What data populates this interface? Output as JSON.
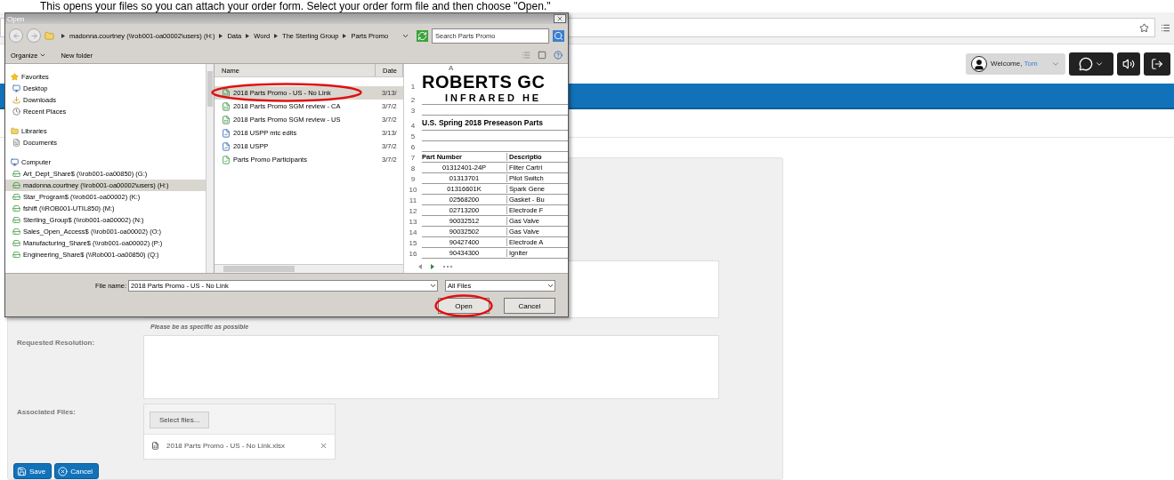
{
  "caption": "This opens your files so you can attach your order form. Select your order form file and then choose \"Open.\"",
  "header": {
    "welcome": "Welcome,",
    "user": "Tom"
  },
  "form": {
    "hint": "Please be as specific as possible",
    "resolution_label": "Requested Resolution:",
    "files_label": "Associated Files:",
    "select_button": "Select files...",
    "attached": [
      {
        "name": "2018 Parts Promo - US - No Link.xlsx"
      }
    ],
    "buttons": [
      {
        "label": "Save",
        "kind": "save"
      },
      {
        "label": "Cancel",
        "kind": "cancel"
      }
    ]
  },
  "dialog": {
    "title": "Open",
    "breadcrumb": [
      "madonna.courtney (\\\\rob001-oa00002\\users) (H:)",
      "Data",
      "Word",
      "The Sterling Group",
      "Parts Promo"
    ],
    "search_placeholder": "Search Parts Promo",
    "toolbar": [
      "Organize",
      "New folder"
    ],
    "nav": [
      {
        "label": "Favorites",
        "kind": "favorites",
        "children": [
          {
            "label": "Desktop",
            "kind": "desktop",
            "selected": false
          },
          {
            "label": "Downloads",
            "kind": "downloads",
            "selected": false
          },
          {
            "label": "Recent Places",
            "kind": "recent",
            "selected": false
          }
        ]
      },
      {
        "label": "Libraries",
        "kind": "libraries",
        "children": [
          {
            "label": "Documents",
            "kind": "document",
            "selected": false
          }
        ]
      },
      {
        "label": "Computer",
        "kind": "computer",
        "children": [
          {
            "label": "Art_Dept_Share$ (\\\\rob001-oa00850) (G:)",
            "kind": "drive",
            "selected": false
          },
          {
            "label": "madonna.courtney (\\\\rob001-oa00002\\users) (H:)",
            "kind": "drive",
            "selected": true
          },
          {
            "label": "Star_Program$ (\\\\rob001-oa00002) (K:)",
            "kind": "drive",
            "selected": false
          },
          {
            "label": "fshift (\\\\ROB001-UTIL850) (M:)",
            "kind": "drive",
            "selected": false
          },
          {
            "label": "Sterling_Group$ (\\\\rob001-oa00002) (N:)",
            "kind": "drive",
            "selected": false
          },
          {
            "label": "Sales_Open_Access$ (\\\\rob001-oa00002) (O:)",
            "kind": "drive",
            "selected": false
          },
          {
            "label": "Manufacturing_Share$ (\\\\rob001-oa00002) (P:)",
            "kind": "drive",
            "selected": false
          },
          {
            "label": "Engineering_Share$ (\\\\Rob001-oa00850) (Q:)",
            "kind": "drive",
            "selected": false
          }
        ]
      }
    ],
    "columns": [
      "Name",
      "Date"
    ],
    "files": [
      {
        "name": "2018 Parts Promo - US - No Link",
        "date": "3/13/",
        "kind": "workbook",
        "selected": true,
        "circled": true
      },
      {
        "name": "2018 Parts Promo SGM review - CA",
        "date": "3/7/2",
        "kind": "workbook",
        "selected": false,
        "circled": false
      },
      {
        "name": "2018 Parts Promo SGM review - US",
        "date": "3/7/2",
        "kind": "workbook",
        "selected": false,
        "circled": false
      },
      {
        "name": "2018 USPP mtc edits",
        "date": "3/13/",
        "kind": "document",
        "selected": false,
        "circled": false
      },
      {
        "name": "2018 USPP",
        "date": "3/7/2",
        "kind": "document",
        "selected": false,
        "circled": false
      },
      {
        "name": "Parts Promo Participants",
        "date": "3/7/2",
        "kind": "list",
        "selected": false,
        "circled": false
      }
    ],
    "preview": {
      "column": "A",
      "rows": [
        {
          "n": "1",
          "kind": "logo",
          "text": "ROBERTS GC"
        },
        {
          "n": "2",
          "kind": "logo-sub",
          "text": "INFRARED HE"
        },
        {
          "n": "3",
          "kind": "blank"
        },
        {
          "n": "4",
          "kind": "title",
          "text": "U.S. Spring 2018 Preseason Parts"
        },
        {
          "n": "5",
          "kind": "blank"
        },
        {
          "n": "6",
          "kind": "blank"
        },
        {
          "n": "7",
          "kind": "header",
          "cells": [
            "Part Number",
            "Descriptio"
          ]
        },
        {
          "n": "8",
          "kind": "data",
          "cells": [
            "01312401-24P",
            "Filter Cartri"
          ]
        },
        {
          "n": "9",
          "kind": "data",
          "cells": [
            "01313701",
            "Pilot Switch"
          ]
        },
        {
          "n": "10",
          "kind": "data",
          "cells": [
            "01316601K",
            "Spark Gene"
          ]
        },
        {
          "n": "11",
          "kind": "data",
          "cells": [
            "02568200",
            "Gasket - Bu"
          ]
        },
        {
          "n": "12",
          "kind": "data",
          "cells": [
            "02713200",
            "Electrode F"
          ]
        },
        {
          "n": "13",
          "kind": "data",
          "cells": [
            "90032512",
            "Gas Valve"
          ]
        },
        {
          "n": "14",
          "kind": "data",
          "cells": [
            "90032502",
            "Gas Valve"
          ]
        },
        {
          "n": "15",
          "kind": "data",
          "cells": [
            "90427400",
            "Electrode A"
          ]
        },
        {
          "n": "16",
          "kind": "data",
          "cells": [
            "90434300",
            "Igniter"
          ]
        }
      ]
    },
    "file_name_label": "File name:",
    "file_name": "2018 Parts Promo - US - No Link",
    "filter": "All Files",
    "buttons": [
      {
        "label": "Open",
        "circled": true
      },
      {
        "label": "Cancel",
        "circled": false
      }
    ]
  }
}
